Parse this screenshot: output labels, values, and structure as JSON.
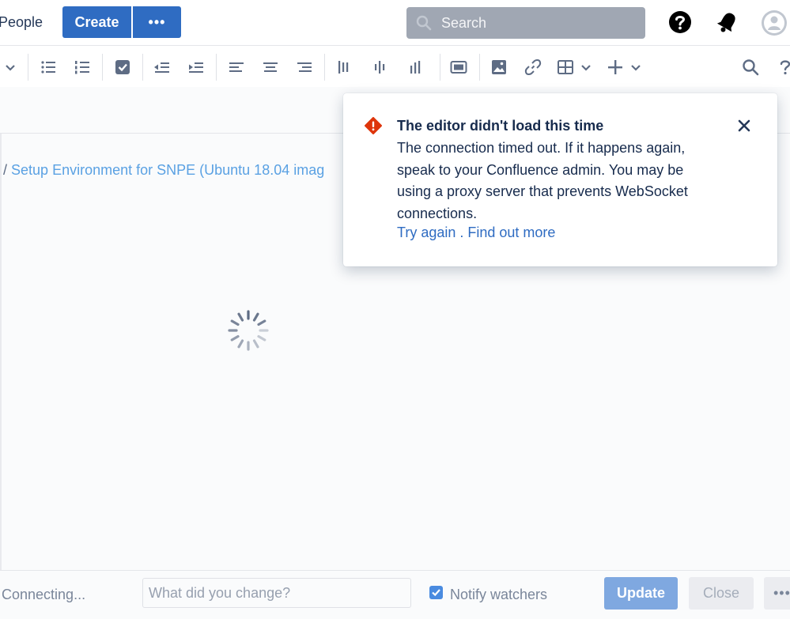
{
  "nav": {
    "people_label": "People",
    "create_label": "Create",
    "more_label": "•••",
    "search_placeholder": "Search"
  },
  "toolbar": {
    "icons": [
      "chevron-down-icon",
      "bullet-list-icon",
      "numbered-list-icon",
      "task-list-icon",
      "outdent-icon",
      "indent-icon",
      "align-left-icon",
      "align-center-icon",
      "align-right-icon",
      "layout-left-icon",
      "layout-center-icon",
      "layout-right-icon",
      "page-layout-icon",
      "image-icon",
      "link-icon",
      "table-icon",
      "insert-plus-icon",
      "find-icon",
      "help-icon"
    ]
  },
  "breadcrumb": {
    "separator": "/",
    "page": "Setup Environment for SNPE (Ubuntu 18.04 imag"
  },
  "flag": {
    "title": "The editor didn't load this time",
    "body": "The connection timed out. If it happens again, speak to your Confluence admin. You may be using a proxy server that prevents WebSocket connections.",
    "try_again": "Try again",
    "dot": " . ",
    "find_out": "Find out more",
    "error_color": "#de350b"
  },
  "footer": {
    "status": "Connecting...",
    "change_placeholder": "What did you change?",
    "notify_label": "Notify watchers",
    "notify_checked": true,
    "update_label": "Update",
    "close_label": "Close",
    "more_label": "•••"
  },
  "colors": {
    "brand": "#2f6cc2",
    "link": "#5aa1e3"
  }
}
